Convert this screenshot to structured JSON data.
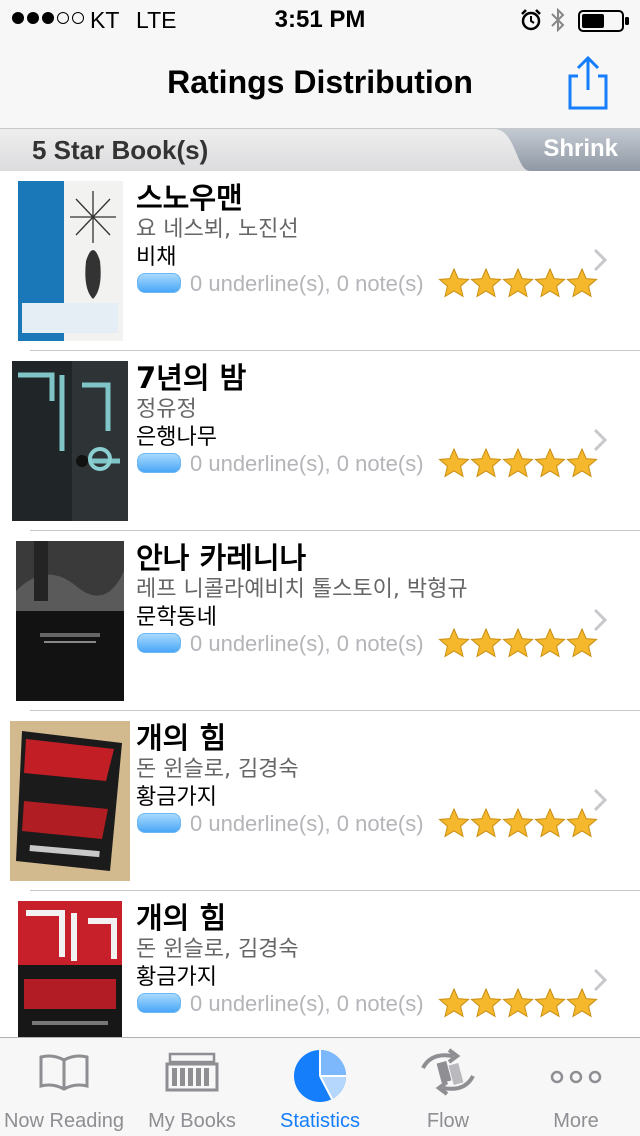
{
  "status_bar": {
    "carrier": "KT",
    "network": "LTE",
    "time": "3:51 PM",
    "signal_bars_filled": 3,
    "signal_bars_total": 5,
    "icons": [
      "alarm-icon",
      "bluetooth-icon",
      "battery-icon"
    ]
  },
  "nav": {
    "title": "Ratings Distribution",
    "share_icon": "share-icon"
  },
  "section": {
    "title": "5 Star Book(s)",
    "shrink_label": "Shrink"
  },
  "books": [
    {
      "title": "스노우맨",
      "author": "요 네스뵈, 노진선",
      "publisher": "비채",
      "notes": "0 underline(s), 0 note(s)",
      "rating": 5
    },
    {
      "title": "7년의 밤",
      "author": "정유정",
      "publisher": "은행나무",
      "notes": "0 underline(s), 0 note(s)",
      "rating": 5
    },
    {
      "title": "안나 카레니나",
      "author": "레프 니콜라예비치 톨스토이, 박형규",
      "publisher": "문학동네",
      "notes": "0 underline(s), 0 note(s)",
      "rating": 5
    },
    {
      "title": "개의 힘",
      "author": "돈 윈슬로, 김경숙",
      "publisher": "황금가지",
      "notes": "0 underline(s), 0 note(s)",
      "rating": 5
    },
    {
      "title": "개의 힘",
      "author": "돈 윈슬로, 김경숙",
      "publisher": "황금가지",
      "notes": "0 underline(s), 0 note(s)",
      "rating": 5
    }
  ],
  "tabs": [
    {
      "label": "Now Reading",
      "icon": "open-book-icon",
      "active": false
    },
    {
      "label": "My Books",
      "icon": "bookshelf-icon",
      "active": false
    },
    {
      "label": "Statistics",
      "icon": "pie-chart-icon",
      "active": true
    },
    {
      "label": "Flow",
      "icon": "flow-arrows-icon",
      "active": false
    },
    {
      "label": "More",
      "icon": "more-dots-icon",
      "active": false
    }
  ],
  "colors": {
    "accent": "#147efb",
    "star": "#f5b72b",
    "nav_background": "#f7f7f7",
    "inactive_tab": "#8e8e93"
  }
}
